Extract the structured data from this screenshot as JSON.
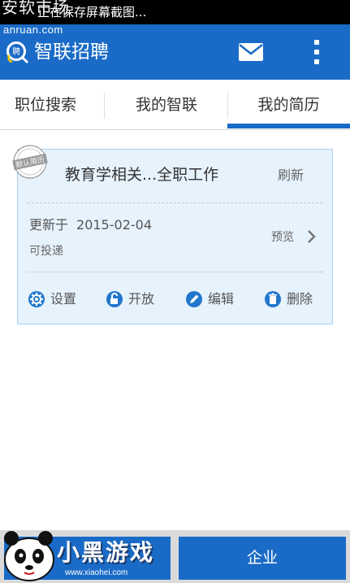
{
  "status_bar": {
    "message": "正在保存屏幕截图...",
    "watermark_cn": "安软市场",
    "watermark_url": "anruan.com"
  },
  "action_bar": {
    "title": "智联招聘",
    "logo_icon": "zhilian-logo-icon",
    "mail_icon": "mail-icon",
    "more_icon": "overflow-menu-icon",
    "color": "#1a6bc7"
  },
  "tabs": [
    {
      "label": "职位搜索",
      "selected": false
    },
    {
      "label": "我的智联",
      "selected": false
    },
    {
      "label": "我的简历",
      "selected": true
    }
  ],
  "resume": {
    "stamp": "默认简历",
    "title": "教育学相关...全职工作",
    "refresh_label": "刷新",
    "updated_label": "更新于",
    "updated_date": "2015-02-04",
    "status": "可投递",
    "preview_label": "预览",
    "actions": [
      {
        "label": "设置",
        "icon": "gear-icon"
      },
      {
        "label": "开放",
        "icon": "unlock-icon"
      },
      {
        "label": "编辑",
        "icon": "pencil-icon"
      },
      {
        "label": "删除",
        "icon": "trash-icon"
      }
    ]
  },
  "bottom": {
    "left_label": "",
    "right_label": "企业",
    "watermark_text": "小黑游戏",
    "watermark_url": "www.xiaohei.com"
  }
}
